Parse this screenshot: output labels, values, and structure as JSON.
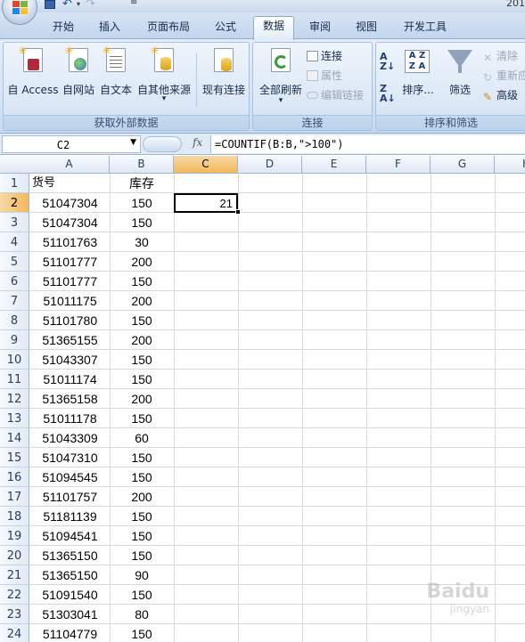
{
  "title": {
    "app_title_fragment": "201"
  },
  "tabs": [
    "开始",
    "插入",
    "页面布局",
    "公式",
    "数据",
    "审阅",
    "视图",
    "开发工具"
  ],
  "active_tab": "数据",
  "ribbon": {
    "get_external": {
      "label": "获取外部数据",
      "buttons": [
        "自 Access",
        "自网站",
        "自文本",
        "自其他来源"
      ],
      "existing_connections": "现有连接"
    },
    "connections": {
      "label": "连接",
      "refresh_all": "全部刷新",
      "connections": "连接",
      "properties": "属性",
      "edit_links": "编辑链接"
    },
    "sort_filter": {
      "label": "排序和筛选",
      "sort": "排序...",
      "filter": "筛选",
      "clear": "清除",
      "reapply": "重新应",
      "advanced": "高级"
    }
  },
  "formula_bar": {
    "name_box": "C2",
    "fx": "fx",
    "formula": "=COUNTIF(B:B,\">100\")"
  },
  "columns": [
    "A",
    "B",
    "C",
    "D",
    "E",
    "F",
    "G",
    "H"
  ],
  "selected_column": "C",
  "selected_row": 2,
  "rows": [
    "1",
    "2",
    "3",
    "4",
    "5",
    "6",
    "7",
    "8",
    "9",
    "10",
    "11",
    "12",
    "13",
    "14",
    "15",
    "16",
    "17",
    "18",
    "19",
    "20",
    "21",
    "22",
    "23",
    "24"
  ],
  "headers": {
    "a": "货号",
    "b": "库存"
  },
  "data": [
    [
      "51047304",
      "150"
    ],
    [
      "51047304",
      "150"
    ],
    [
      "51101763",
      "30"
    ],
    [
      "51101777",
      "200"
    ],
    [
      "51101777",
      "150"
    ],
    [
      "51011175",
      "200"
    ],
    [
      "51101780",
      "150"
    ],
    [
      "51365155",
      "200"
    ],
    [
      "51043307",
      "150"
    ],
    [
      "51011174",
      "150"
    ],
    [
      "51365158",
      "200"
    ],
    [
      "51011178",
      "150"
    ],
    [
      "51043309",
      "60"
    ],
    [
      "51047310",
      "150"
    ],
    [
      "51094545",
      "150"
    ],
    [
      "51101757",
      "200"
    ],
    [
      "51181139",
      "150"
    ],
    [
      "51094541",
      "150"
    ],
    [
      "51365150",
      "150"
    ],
    [
      "51365150",
      "90"
    ],
    [
      "51091540",
      "150"
    ],
    [
      "51303041",
      "80"
    ],
    [
      "51104779",
      "150"
    ]
  ],
  "active_cell_value": "21",
  "watermark": {
    "main": "Baidu",
    "sub": "jingyan"
  },
  "colors": {
    "ribbon": "#dbe7f6",
    "selected_header": "#f2b85c",
    "grid_line": "#d4d9df"
  }
}
